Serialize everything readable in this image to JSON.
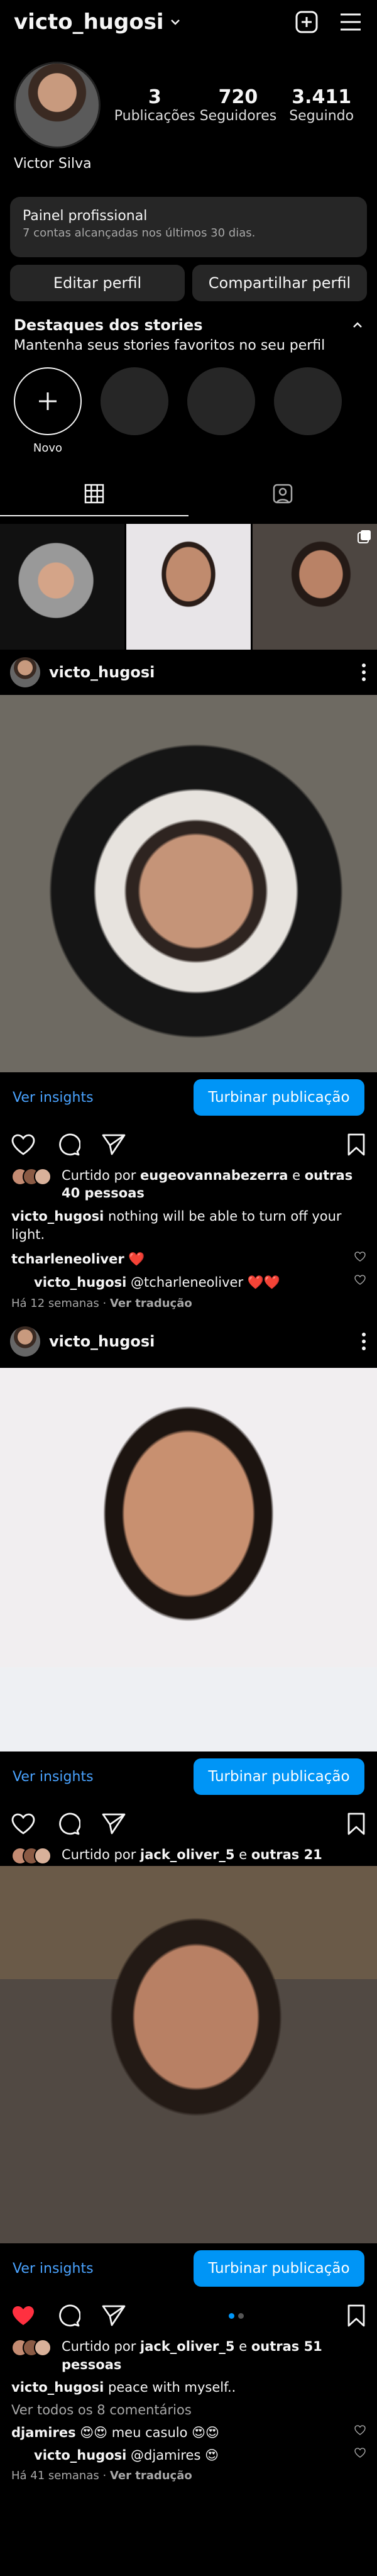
{
  "header": {
    "username": "victo_hugosi"
  },
  "profile": {
    "stats": [
      {
        "value": "3",
        "label": "Publicações"
      },
      {
        "value": "720",
        "label": "Seguidores"
      },
      {
        "value": "3.411",
        "label": "Seguindo"
      }
    ],
    "full_name": "Victor Silva"
  },
  "panel": {
    "title": "Painel profissional",
    "subtitle": "7 contas alcançadas nos últimos 30 dias."
  },
  "buttons": {
    "edit": "Editar perfil",
    "share": "Compartilhar perfil"
  },
  "highlights": {
    "title": "Destaques dos stories",
    "subtitle": "Mantenha seus stories favoritos no seu perfil",
    "new_label": "Novo"
  },
  "posts": [
    {
      "username": "victo_hugosi",
      "insights": "Ver insights",
      "boost": "Turbinar publicação",
      "liked_prefix": "Curtido por ",
      "liked_user": "eugeovannabezerra",
      "liked_mid": " e ",
      "liked_others": "outras 40 pessoas",
      "caption_user": "victo_hugosi",
      "caption_text": " nothing will be able to turn off your light.",
      "comments": [
        {
          "user": "tcharleneoliver",
          "text": " ❤️"
        },
        {
          "user": "victo_hugosi",
          "text": " @tcharleneoliver ❤️❤️"
        }
      ],
      "time": "Há 12 semanas",
      "translate": "Ver tradução"
    },
    {
      "username": "victo_hugosi",
      "insights": "Ver insights",
      "boost": "Turbinar publicação",
      "liked_prefix": "Curtido por ",
      "liked_user": "jack_oliver_5",
      "liked_mid": " e ",
      "liked_others": "outras 21"
    },
    {
      "insights": "Ver insights",
      "boost": "Turbinar publicação",
      "liked_prefix": "Curtido por ",
      "liked_user": "jack_oliver_5",
      "liked_mid": " e ",
      "liked_others": "outras 51 pessoas",
      "caption_user": "victo_hugosi",
      "caption_text": " peace with myself..",
      "view_comments": "Ver todos os 8 comentários",
      "comments": [
        {
          "user": "djamires",
          "text": " 😍😍 meu casulo 😍😍"
        },
        {
          "user": "victo_hugosi",
          "text": " @djamires 😍"
        }
      ],
      "time": "Há 41 semanas",
      "translate": "Ver tradução"
    }
  ],
  "colors": {
    "accent": "#0095f6",
    "link": "#4aa3ff",
    "like": "#ff3040",
    "surface": "#262626"
  }
}
